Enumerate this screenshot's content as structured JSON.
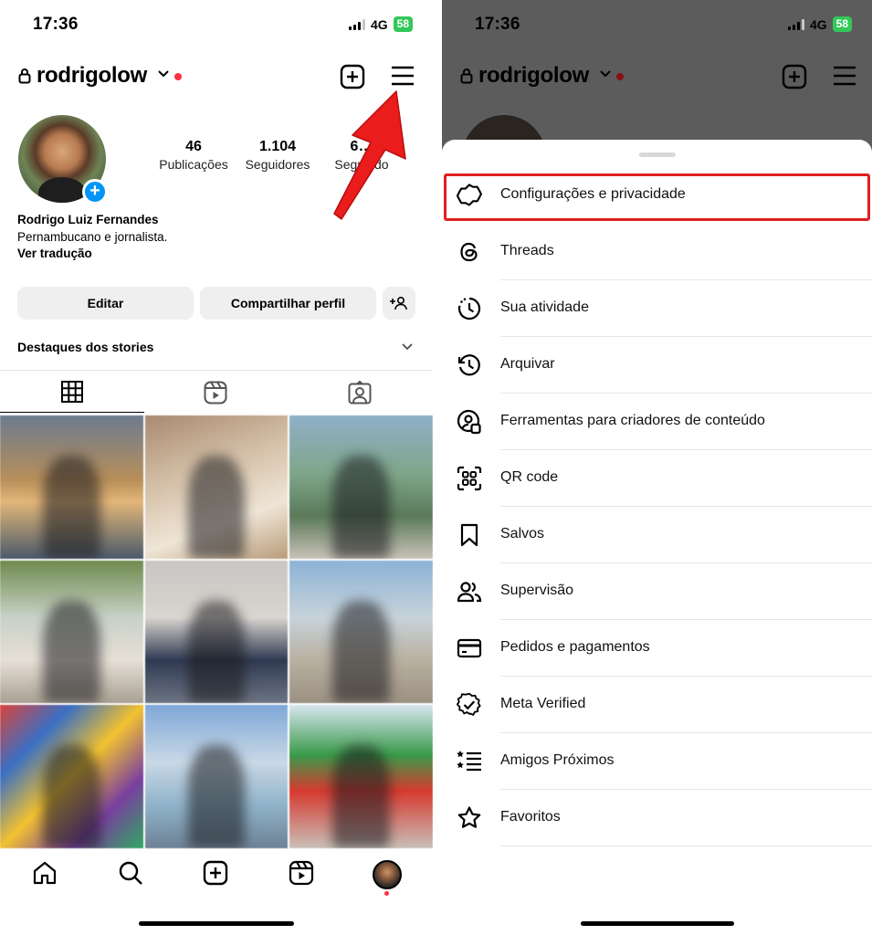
{
  "status_bar": {
    "time": "17:36",
    "network": "4G",
    "battery": "58"
  },
  "profile": {
    "username": "rodrigolow",
    "stats": [
      {
        "value": "46",
        "label": "Publicações"
      },
      {
        "value": "1.104",
        "label": "Seguidores"
      },
      {
        "value": "6…",
        "label": "Seguindo"
      }
    ],
    "name": "Rodrigo Luiz Fernandes",
    "bio": "Pernambucano e jornalista.",
    "translate_link": "Ver tradução",
    "buttons": {
      "edit": "Editar",
      "share": "Compartilhar perfil"
    },
    "highlights_label": "Destaques dos stories"
  },
  "tabs": [
    "grid-icon",
    "reels-icon",
    "tagged-icon"
  ],
  "bottom_nav": [
    "home-icon",
    "search-icon",
    "create-icon",
    "reels-icon",
    "profile-avatar"
  ],
  "menu": {
    "items": [
      {
        "label": "Configurações e privacidade",
        "icon": "gear-icon"
      },
      {
        "label": "Threads",
        "icon": "threads-icon"
      },
      {
        "label": "Sua atividade",
        "icon": "activity-icon"
      },
      {
        "label": "Arquivar",
        "icon": "archive-icon"
      },
      {
        "label": "Ferramentas para criadores de conteúdo",
        "icon": "creator-tools-icon"
      },
      {
        "label": "QR code",
        "icon": "qr-code-icon"
      },
      {
        "label": "Salvos",
        "icon": "bookmark-icon"
      },
      {
        "label": "Supervisão",
        "icon": "supervision-icon"
      },
      {
        "label": "Pedidos e pagamentos",
        "icon": "card-icon"
      },
      {
        "label": "Meta Verified",
        "icon": "verified-icon"
      },
      {
        "label": "Amigos Próximos",
        "icon": "close-friends-icon"
      },
      {
        "label": "Favoritos",
        "icon": "star-icon"
      }
    ]
  },
  "colors": {
    "accent_blue": "#0095f6",
    "notification_red": "#ff3040",
    "annotation_red": "#e0201e",
    "battery_green": "#34c759"
  }
}
